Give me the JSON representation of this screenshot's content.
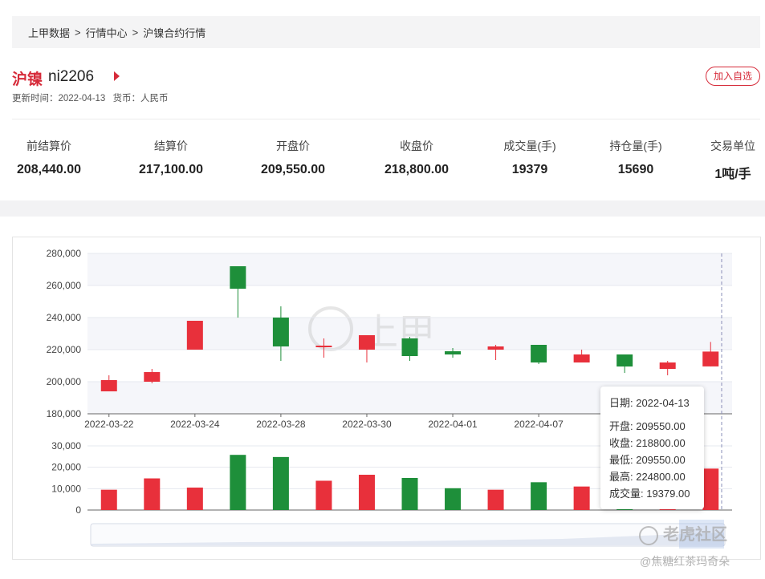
{
  "breadcrumb": [
    "上甲数据",
    ">",
    "行情中心",
    ">",
    "沪镍合约行情"
  ],
  "header": {
    "name": "沪镍",
    "code": "ni2206",
    "add_button": "加入自选",
    "update_label": "更新时间：",
    "update_time": "2022-04-13",
    "currency_label": "货币：",
    "currency": "人民币"
  },
  "stats": [
    {
      "label": "前结算价",
      "value": "208,440.00"
    },
    {
      "label": "结算价",
      "value": "217,100.00"
    },
    {
      "label": "开盘价",
      "value": "209,550.00"
    },
    {
      "label": "收盘价",
      "value": "218,800.00"
    },
    {
      "label": "成交量(手)",
      "value": "19379"
    },
    {
      "label": "持仓量(手)",
      "value": "15690"
    },
    {
      "label": "交易单位",
      "value": "1吨/手"
    }
  ],
  "chart_data": {
    "type": "candlestick",
    "price_axis": {
      "ticks": [
        "180,000",
        "200,000",
        "220,000",
        "240,000",
        "260,000",
        "280,000"
      ],
      "ylim": [
        180000,
        280000
      ]
    },
    "volume_axis": {
      "ticks": [
        "0",
        "10,000",
        "20,000",
        "30,000"
      ],
      "ylim": [
        0,
        30000
      ]
    },
    "x_tick_labels": [
      "2022-03-22",
      "2022-03-24",
      "2022-03-28",
      "2022-03-30",
      "2022-04-01",
      "2022-04-07",
      "2022-04-13"
    ],
    "colors": {
      "up": "#e8303b",
      "down": "#1e8f3a"
    },
    "candles": [
      {
        "open": 194000,
        "close": 201000,
        "high": 204000,
        "low": 194000,
        "volume": 9500
      },
      {
        "open": 200000,
        "close": 206000,
        "high": 208000,
        "low": 199000,
        "volume": 14800
      },
      {
        "open": 220000,
        "close": 238000,
        "high": 238000,
        "low": 220000,
        "volume": 10500
      },
      {
        "open": 272000,
        "close": 258000,
        "high": 272000,
        "low": 240000,
        "volume": 25800
      },
      {
        "open": 240000,
        "close": 222000,
        "high": 247000,
        "low": 213000,
        "volume": 24800
      },
      {
        "open": 221500,
        "close": 222500,
        "high": 227000,
        "low": 215000,
        "volume": 13700
      },
      {
        "open": 220000,
        "close": 229000,
        "high": 229000,
        "low": 212000,
        "volume": 16500
      },
      {
        "open": 227000,
        "close": 216000,
        "high": 228000,
        "low": 213000,
        "volume": 15000
      },
      {
        "open": 219000,
        "close": 217000,
        "high": 221000,
        "low": 215000,
        "volume": 10200
      },
      {
        "open": 220000,
        "close": 222000,
        "high": 223000,
        "low": 213500,
        "volume": 9500
      },
      {
        "open": 223000,
        "close": 212000,
        "high": 223000,
        "low": 211000,
        "volume": 13000
      },
      {
        "open": 212000,
        "close": 217000,
        "high": 220000,
        "low": 212000,
        "volume": 11000
      },
      {
        "open": 217000,
        "close": 209500,
        "high": 217000,
        "low": 205500,
        "volume": 11000
      },
      {
        "open": 208000,
        "close": 212000,
        "high": 213000,
        "low": 204000,
        "volume": 10000
      },
      {
        "open": 209550,
        "close": 218800,
        "high": 224800,
        "low": 209550,
        "volume": 19379
      }
    ]
  },
  "tooltip": {
    "date": "日期: 2022-04-13",
    "open": "开盘: 209550.00",
    "close": "收盘: 218800.00",
    "low": "最低: 209550.00",
    "high": "最高: 224800.00",
    "volume": "成交量: 19379.00"
  },
  "watermarks": {
    "center": "上甲",
    "brand": "老虎社区",
    "author": "@焦糖红茶玛奇朵"
  }
}
